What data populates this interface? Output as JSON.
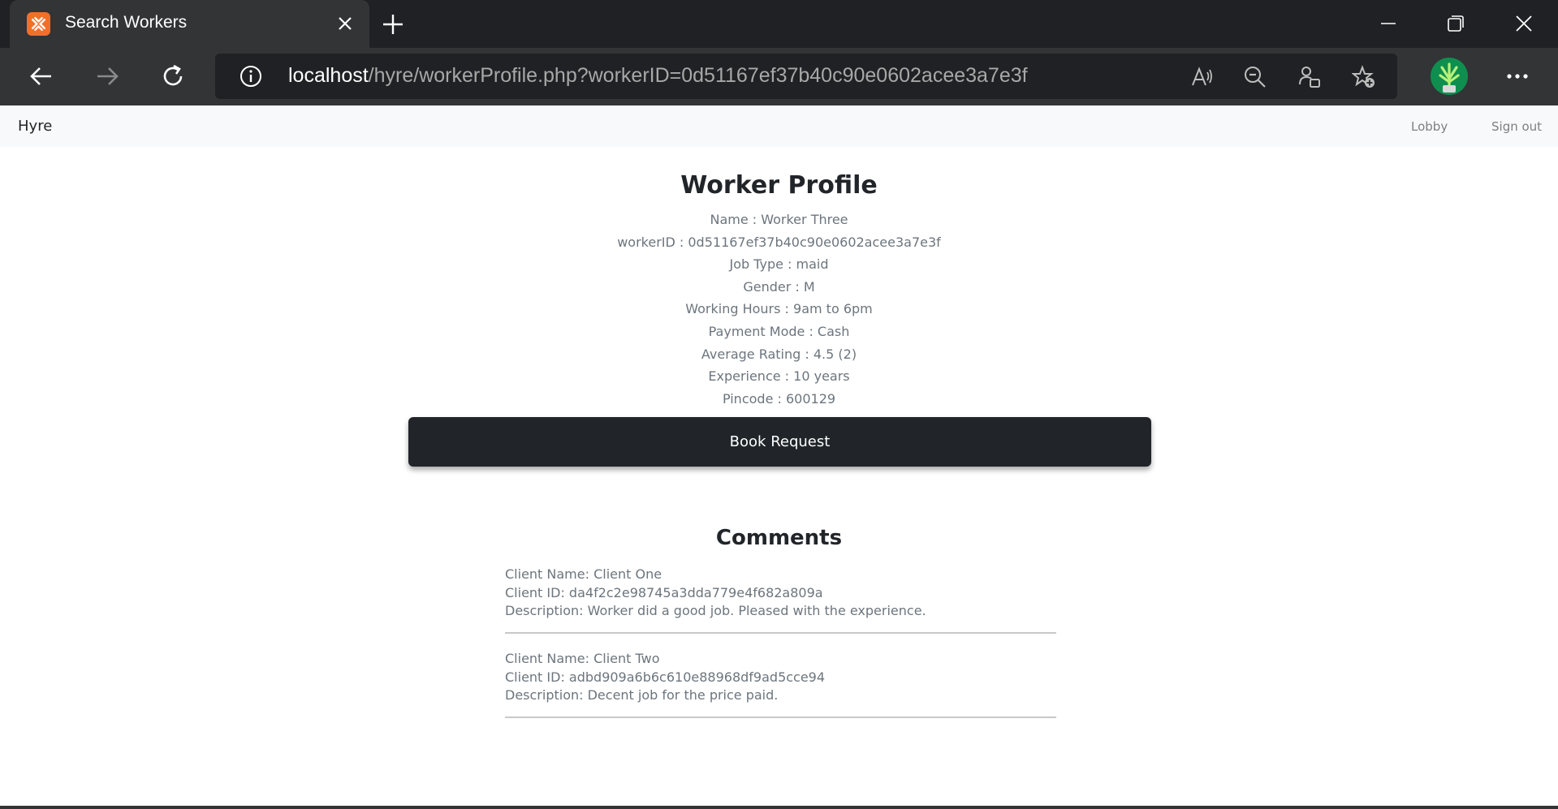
{
  "browser": {
    "tab_title": "Search Workers",
    "url_host": "localhost",
    "url_path": "/hyre/workerProfile.php?workerID=0d51167ef37b40c90e0602acee3a7e3f"
  },
  "navbar": {
    "brand": "Hyre",
    "links": [
      "Lobby",
      "Sign out"
    ]
  },
  "profile": {
    "title": "Worker Profile",
    "fields": [
      "Name : Worker Three",
      "workerID : 0d51167ef37b40c90e0602acee3a7e3f",
      "Job Type : maid",
      "Gender : M",
      "Working Hours : 9am to 6pm",
      "Payment Mode : Cash",
      "Average Rating : 4.5 (2)",
      "Experience : 10 years",
      "Pincode : 600129"
    ],
    "book_button": "Book Request"
  },
  "comments": {
    "title": "Comments",
    "items": [
      {
        "client_name": "Client Name: Client One",
        "client_id": "Client ID: da4f2c2e98745a3dda779e4f682a809a",
        "description": "Description: Worker did a good job. Pleased with the experience."
      },
      {
        "client_name": "Client Name: Client Two",
        "client_id": "Client ID: adbd909a6b6c610e88968df9ad5cce94",
        "description": "Description: Decent job for the price paid."
      }
    ]
  },
  "colors": {
    "chrome_dark": "#202124",
    "chrome_toolbar": "#333436",
    "favicon_orange": "#f0702a",
    "button_dark": "#212529",
    "text_muted": "#6c757d",
    "navbar_bg": "#f8f9fa"
  }
}
